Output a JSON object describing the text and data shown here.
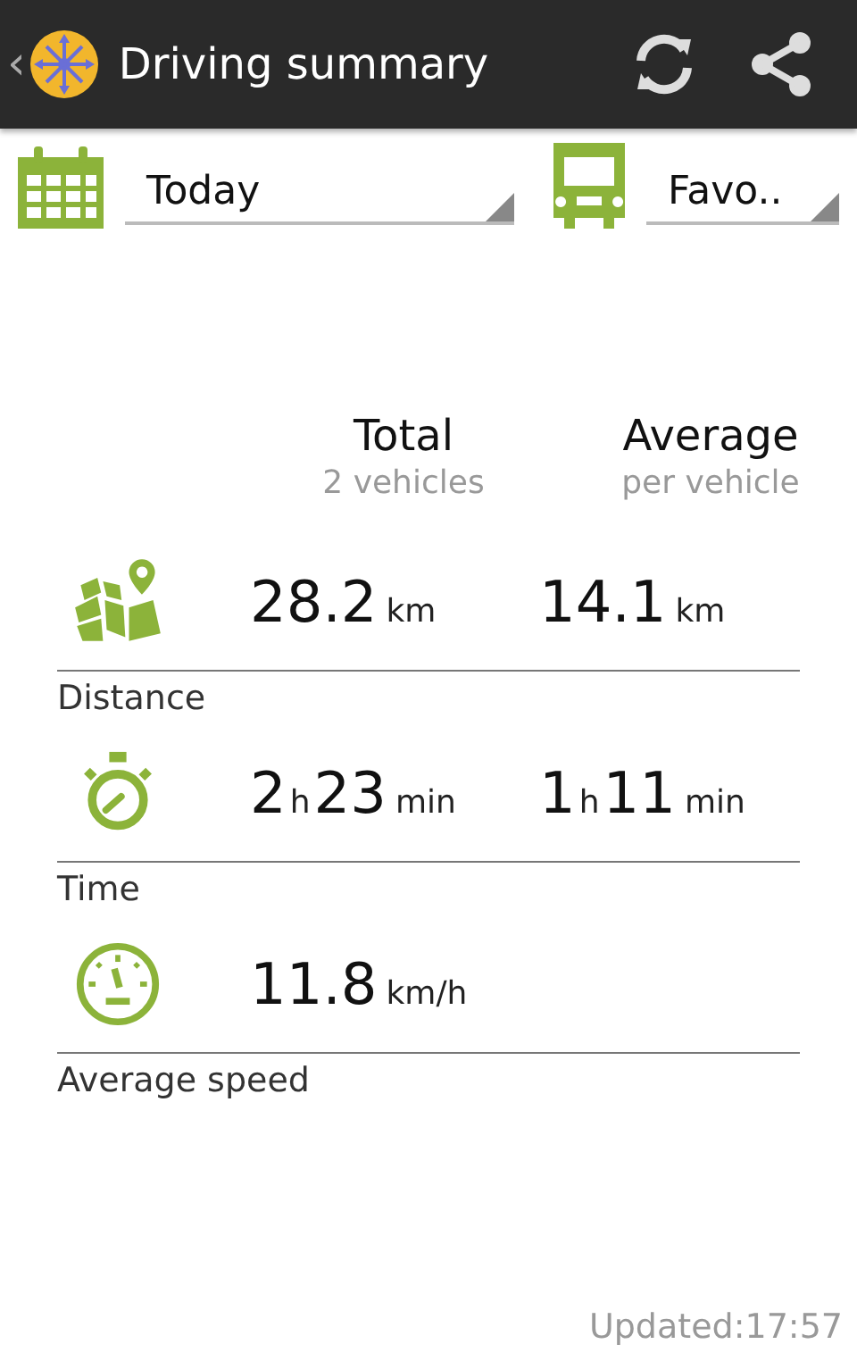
{
  "app_bar": {
    "back": "‹",
    "title": "Driving summary"
  },
  "filters": [
    {
      "kind": "period",
      "value": "Today"
    },
    {
      "kind": "vehicle",
      "value": "Favo.."
    }
  ],
  "columns": [
    {
      "title": "Total",
      "subtitle": "2 vehicles"
    },
    {
      "title": "Average",
      "subtitle": "per vehicle"
    }
  ],
  "metrics": [
    {
      "kind": "distance",
      "label": "Distance",
      "total": [
        {
          "value": "28.2",
          "unit": "km"
        }
      ],
      "average": [
        {
          "value": "14.1",
          "unit": "km"
        }
      ]
    },
    {
      "kind": "time",
      "label": "Time",
      "total": [
        {
          "value": "2",
          "unit": "h"
        },
        {
          "value": "23",
          "unit": "min"
        }
      ],
      "average": [
        {
          "value": "1",
          "unit": "h"
        },
        {
          "value": "11",
          "unit": "min"
        }
      ]
    },
    {
      "kind": "speed",
      "label": "Average speed",
      "total": [
        {
          "value": "11.8",
          "unit": "km/h"
        }
      ]
    }
  ],
  "updated": "Updated:17:57"
}
